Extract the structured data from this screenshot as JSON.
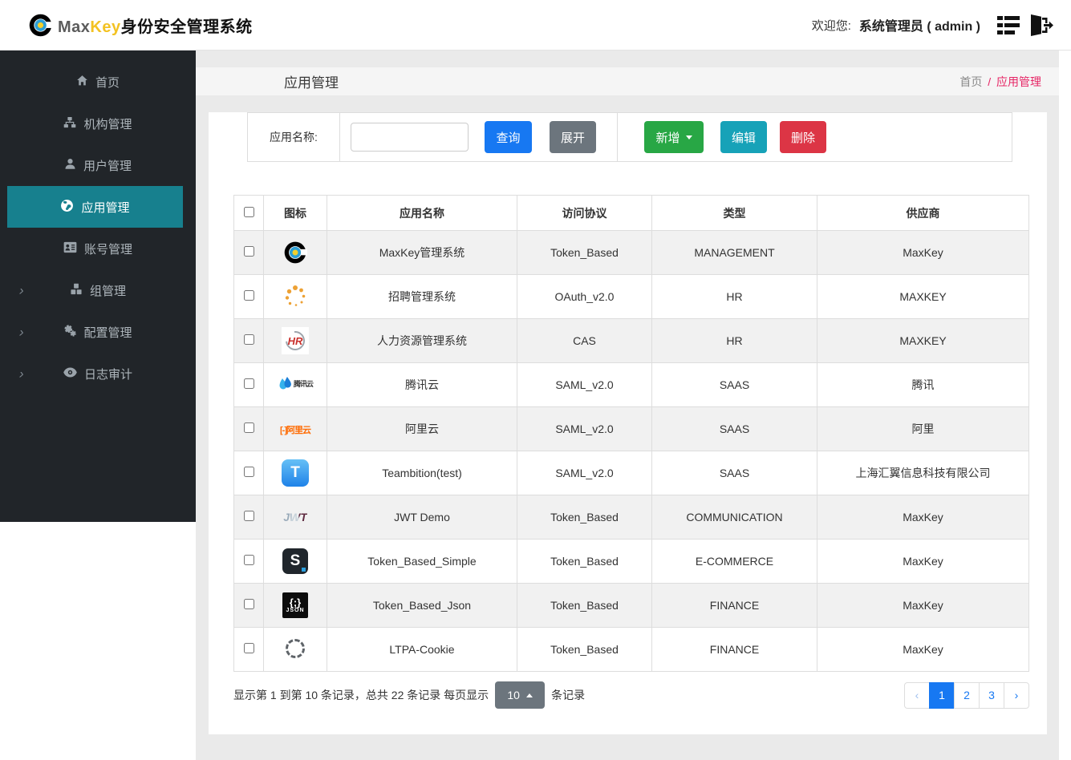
{
  "header": {
    "logo": {
      "max": "Max",
      "key": "Key",
      "suffix": "身份安全管理系统",
      "mark_icon": "maxkey-logo"
    },
    "welcome_label": "欢迎您:",
    "user_name": "系统管理员 ( admin )",
    "list_icon": "list-icon",
    "logout_icon": "logout-icon"
  },
  "sidebar": {
    "items": [
      {
        "label": "首页",
        "icon": "home-icon",
        "active": false,
        "expandable": false
      },
      {
        "label": "机构管理",
        "icon": "sitemap-icon",
        "active": false,
        "expandable": false
      },
      {
        "label": "用户管理",
        "icon": "user-icon",
        "active": false,
        "expandable": false
      },
      {
        "label": "应用管理",
        "icon": "globe-icon",
        "active": true,
        "expandable": false
      },
      {
        "label": "账号管理",
        "icon": "id-card-icon",
        "active": false,
        "expandable": false
      },
      {
        "label": "组管理",
        "icon": "cubes-icon",
        "active": false,
        "expandable": true
      },
      {
        "label": "配置管理",
        "icon": "gears-icon",
        "active": false,
        "expandable": true
      },
      {
        "label": "日志审计",
        "icon": "eye-icon",
        "active": false,
        "expandable": true
      }
    ]
  },
  "page": {
    "title": "应用管理",
    "breadcrumb": {
      "home": "首页",
      "separator": "/",
      "current": "应用管理"
    }
  },
  "toolbar": {
    "search_label": "应用名称:",
    "search_value": "",
    "query_label": "查询",
    "expand_label": "展开",
    "add_label": "新增",
    "edit_label": "编辑",
    "delete_label": "删除"
  },
  "table": {
    "columns": {
      "icon": "图标",
      "name": "应用名称",
      "protocol": "访问协议",
      "type": "类型",
      "vendor": "供应商"
    },
    "rows": [
      {
        "icon": "maxkey-logo",
        "name": "MaxKey管理系统",
        "protocol": "Token_Based",
        "type": "MANAGEMENT",
        "vendor": "MaxKey"
      },
      {
        "icon": "recruit-spinner-logo",
        "name": "招聘管理系统",
        "protocol": "OAuth_v2.0",
        "type": "HR",
        "vendor": "MAXKEY"
      },
      {
        "icon": "hr-logo",
        "name": "人力资源管理系统",
        "protocol": "CAS",
        "type": "HR",
        "vendor": "MAXKEY",
        "icon_text": "HR"
      },
      {
        "icon": "tencent-cloud-logo",
        "name": "腾讯云",
        "protocol": "SAML_v2.0",
        "type": "SAAS",
        "vendor": "腾讯",
        "icon_text": "腾讯云"
      },
      {
        "icon": "aliyun-logo",
        "name": "阿里云",
        "protocol": "SAML_v2.0",
        "type": "SAAS",
        "vendor": "阿里",
        "icon_text": "[-]阿里云"
      },
      {
        "icon": "teambition-logo",
        "name": "Teambition(test)",
        "protocol": "SAML_v2.0",
        "type": "SAAS",
        "vendor": "上海汇翼信息科技有限公司",
        "icon_text": "T"
      },
      {
        "icon": "jwt-logo",
        "name": "JWT Demo",
        "protocol": "Token_Based",
        "type": "COMMUNICATION",
        "vendor": "MaxKey",
        "icon_text": "JWT"
      },
      {
        "icon": "simple-s-logo",
        "name": "Token_Based_Simple",
        "protocol": "Token_Based",
        "type": "E-COMMERCE",
        "vendor": "MaxKey",
        "icon_text": "S"
      },
      {
        "icon": "json-logo",
        "name": "Token_Based_Json",
        "protocol": "Token_Based",
        "type": "FINANCE",
        "vendor": "MaxKey",
        "icon_glyph": "{;}",
        "icon_text": "JSON"
      },
      {
        "icon": "ltpa-crosshair-logo",
        "name": "LTPA-Cookie",
        "protocol": "Token_Based",
        "type": "FINANCE",
        "vendor": "MaxKey"
      }
    ]
  },
  "pagination": {
    "summary_prefix": "显示第 1 到第 10 条记录，总共 22 条记录  每页显示",
    "page_size": "10",
    "summary_suffix": "条记录",
    "prev": "‹",
    "next": "›",
    "pages": [
      "1",
      "2",
      "3"
    ],
    "active_page": "1"
  },
  "colors": {
    "primary": "#1778f2",
    "success": "#28a745",
    "info": "#17a2b8",
    "danger": "#dc3545",
    "secondary": "#6c757d",
    "active_menu": "#17808e",
    "breadcrumb_accent": "#e62565"
  }
}
